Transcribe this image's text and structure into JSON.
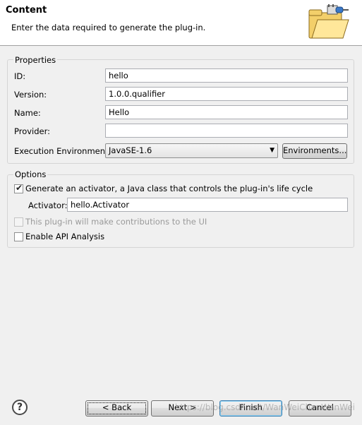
{
  "header": {
    "title": "Content",
    "description": "Enter the data required to generate the plug-in."
  },
  "properties": {
    "group_title": "Properties",
    "id": {
      "label": "ID:",
      "value": "hello"
    },
    "version": {
      "label": "Version:",
      "value": "1.0.0.qualifier"
    },
    "name": {
      "label": "Name:",
      "value": "Hello"
    },
    "provider": {
      "label": "Provider:",
      "value": ""
    },
    "execution_environment": {
      "label": "Execution Environment:",
      "value": "JavaSE-1.6"
    },
    "environments_button": "Environments..."
  },
  "options": {
    "group_title": "Options",
    "generate_activator": {
      "label": "Generate an activator, a Java class that controls the plug-in's life cycle",
      "checked": true
    },
    "activator": {
      "label": "Activator:",
      "value": "hello.Activator"
    },
    "ui_contributions": {
      "label": "This plug-in will make contributions to the UI",
      "checked": false,
      "disabled": true
    },
    "api_analysis": {
      "label": "Enable API Analysis",
      "checked": false
    }
  },
  "footer": {
    "back": "< Back",
    "next": "Next >",
    "finish": "Finish",
    "cancel": "Cancel",
    "watermark": "https://blog.csdn.net/WanWeiChanWanWei"
  },
  "icons": {
    "help": "help-icon",
    "wizard_banner": "plugin-folder-icon"
  }
}
